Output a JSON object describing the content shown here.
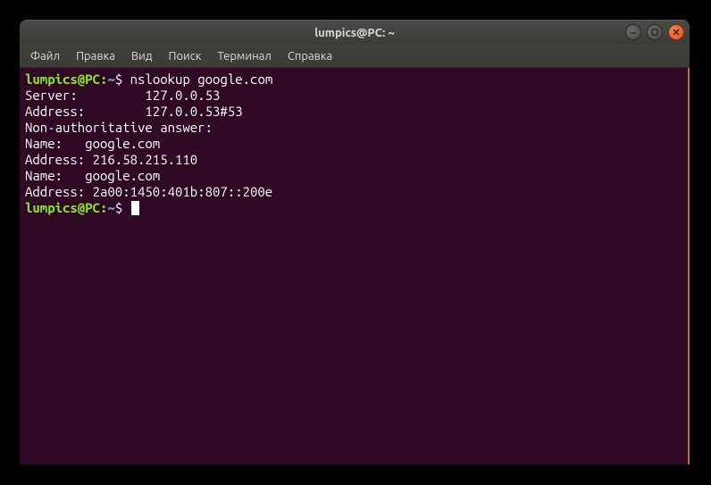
{
  "window": {
    "title": "lumpics@PC: ~"
  },
  "menubar": {
    "items": [
      "Файл",
      "Правка",
      "Вид",
      "Поиск",
      "Терминал",
      "Справка"
    ]
  },
  "prompt": {
    "user_host": "lumpics@PC",
    "colon": ":",
    "path": "~",
    "dollar": "$"
  },
  "session": {
    "command": "nslookup google.com",
    "output": [
      "Server:         127.0.0.53",
      "Address:        127.0.0.53#53",
      "",
      "Non-authoritative answer:",
      "Name:   google.com",
      "Address: 216.58.215.110",
      "Name:   google.com",
      "Address: 2a00:1450:401b:807::200e",
      ""
    ]
  }
}
